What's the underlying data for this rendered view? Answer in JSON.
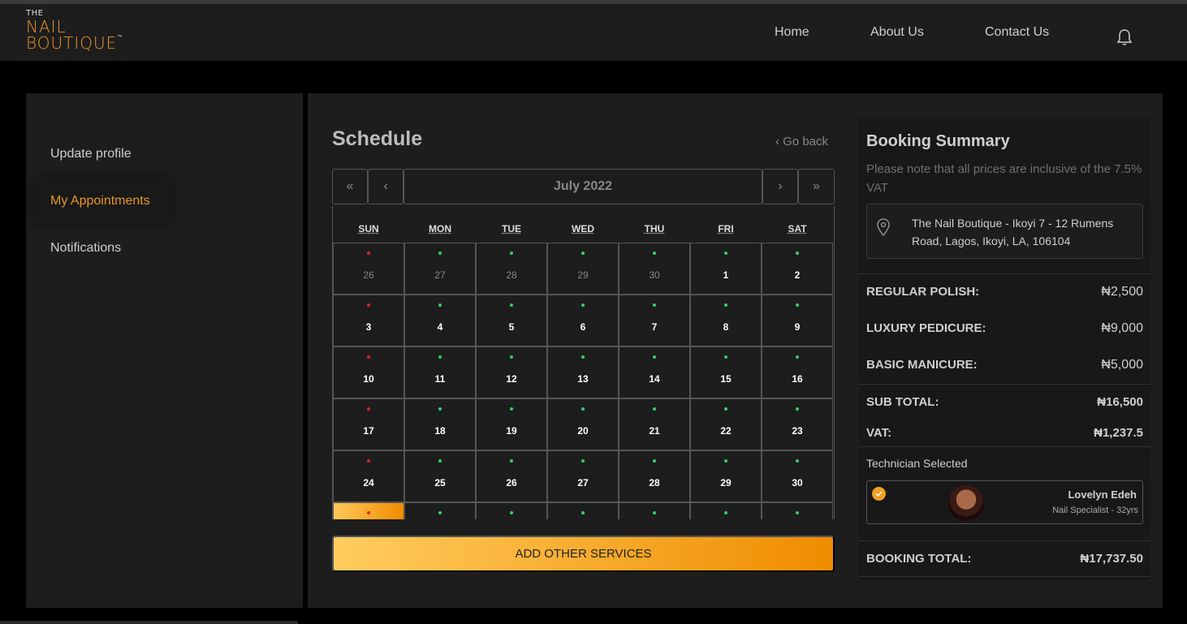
{
  "brand": {
    "the": "THE",
    "line1": "NAIL",
    "line2": "BOUTIQUE",
    "tm": "™",
    "accent": "#e8962a"
  },
  "nav": {
    "home": "Home",
    "about": "About Us",
    "contact": "Contact Us",
    "bell_icon": "bell-icon"
  },
  "sidebar": {
    "items": [
      {
        "label": "Update profile",
        "active": false
      },
      {
        "label": "My Appointments",
        "active": true
      },
      {
        "label": "Notifications",
        "active": false
      }
    ]
  },
  "schedule": {
    "title": "Schedule",
    "go_back": "‹ Go back",
    "calendar": {
      "first": "«",
      "prev": "‹",
      "month": "July 2022",
      "next": "›",
      "last": "»",
      "days_of_week": [
        "SUN",
        "MON",
        "TUE",
        "WED",
        "THU",
        "FRI",
        "SAT"
      ],
      "weeks": [
        [
          {
            "n": "26",
            "muted": true,
            "dot": "red"
          },
          {
            "n": "27",
            "muted": true,
            "dot": "green"
          },
          {
            "n": "28",
            "muted": true,
            "dot": "green"
          },
          {
            "n": "29",
            "muted": true,
            "dot": "green"
          },
          {
            "n": "30",
            "muted": true,
            "dot": "green"
          },
          {
            "n": "1",
            "dot": "green"
          },
          {
            "n": "2",
            "dot": "green"
          }
        ],
        [
          {
            "n": "3",
            "dot": "red"
          },
          {
            "n": "4",
            "dot": "green"
          },
          {
            "n": "5",
            "dot": "green"
          },
          {
            "n": "6",
            "dot": "green"
          },
          {
            "n": "7",
            "dot": "green"
          },
          {
            "n": "8",
            "dot": "green"
          },
          {
            "n": "9",
            "dot": "green"
          }
        ],
        [
          {
            "n": "10",
            "dot": "red"
          },
          {
            "n": "11",
            "dot": "green"
          },
          {
            "n": "12",
            "dot": "green"
          },
          {
            "n": "13",
            "dot": "green"
          },
          {
            "n": "14",
            "dot": "green"
          },
          {
            "n": "15",
            "dot": "green"
          },
          {
            "n": "16",
            "dot": "green"
          }
        ],
        [
          {
            "n": "17",
            "dot": "red"
          },
          {
            "n": "18",
            "dot": "green"
          },
          {
            "n": "19",
            "dot": "green"
          },
          {
            "n": "20",
            "dot": "green"
          },
          {
            "n": "21",
            "dot": "green"
          },
          {
            "n": "22",
            "dot": "green"
          },
          {
            "n": "23",
            "dot": "green"
          }
        ],
        [
          {
            "n": "24",
            "dot": "red"
          },
          {
            "n": "25",
            "dot": "green"
          },
          {
            "n": "26",
            "dot": "green"
          },
          {
            "n": "27",
            "dot": "green"
          },
          {
            "n": "28",
            "dot": "green"
          },
          {
            "n": "29",
            "dot": "green"
          },
          {
            "n": "30",
            "dot": "green"
          }
        ],
        [
          {
            "n": "",
            "dot": "red",
            "selected": true
          },
          {
            "n": "",
            "dot": "green"
          },
          {
            "n": "",
            "dot": "green"
          },
          {
            "n": "",
            "dot": "green"
          },
          {
            "n": "",
            "dot": "green"
          },
          {
            "n": "",
            "dot": "green"
          },
          {
            "n": "",
            "dot": "green"
          }
        ]
      ]
    },
    "add_services": "ADD OTHER SERVICES"
  },
  "summary": {
    "title": "Booking Summary",
    "note": "Please note that all prices are inclusive of the 7.5% VAT",
    "address": "The Nail Boutique - Ikoyi 7 - 12 Rumens Road, Lagos, Ikoyi, LA, 106104",
    "services": [
      {
        "label": "REGULAR POLISH:",
        "price": "₦2,500"
      },
      {
        "label": "LUXURY PEDICURE:",
        "price": "₦9,000"
      },
      {
        "label": "BASIC MANICURE:",
        "price": "₦5,000"
      }
    ],
    "subtotal_label": "SUB TOTAL:",
    "subtotal": "₦16,500",
    "vat_label": "VAT:",
    "vat": "₦1,237.5",
    "technician_label": "Technician Selected",
    "technician": {
      "name": "Lovelyn Edeh",
      "role": "Nail Specialist - 32yrs"
    },
    "total_label": "BOOKING TOTAL:",
    "total": "₦17,737.50"
  },
  "colors": {
    "green_dot": "#2fd36b",
    "red_dot": "#e02020",
    "button_from": "#ffcd5f",
    "button_to": "#f08c00"
  }
}
